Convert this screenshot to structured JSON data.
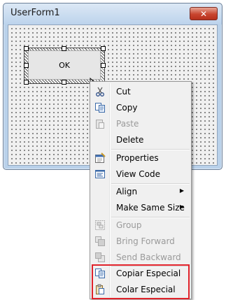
{
  "window": {
    "title": "UserForm1",
    "close_label": "✕"
  },
  "form": {
    "ok_button_label": "OK"
  },
  "context_menu": {
    "items": [
      {
        "label": "Cut",
        "icon": "scissors-icon",
        "enabled": true
      },
      {
        "label": "Copy",
        "icon": "copy-icon",
        "enabled": true
      },
      {
        "label": "Paste",
        "icon": "paste-icon",
        "enabled": false
      },
      {
        "label": "Delete",
        "icon": "",
        "enabled": true
      },
      {
        "label": "Properties",
        "icon": "properties-icon",
        "enabled": true
      },
      {
        "label": "View Code",
        "icon": "view-code-icon",
        "enabled": true
      },
      {
        "label": "Align",
        "icon": "",
        "enabled": true,
        "submenu": true
      },
      {
        "label": "Make Same Size",
        "icon": "",
        "enabled": true,
        "submenu": true
      },
      {
        "label": "Group",
        "icon": "group-icon",
        "enabled": false
      },
      {
        "label": "Bring Forward",
        "icon": "bring-forward-icon",
        "enabled": false
      },
      {
        "label": "Send Backward",
        "icon": "send-backward-icon",
        "enabled": false
      },
      {
        "label": "Copiar Especial",
        "icon": "copy-special-icon",
        "enabled": true
      },
      {
        "label": "Colar Especial",
        "icon": "paste-special-icon",
        "enabled": true
      }
    ]
  },
  "colors": {
    "highlight_box": "#e0222a",
    "disabled_text": "#9a9a9a"
  }
}
